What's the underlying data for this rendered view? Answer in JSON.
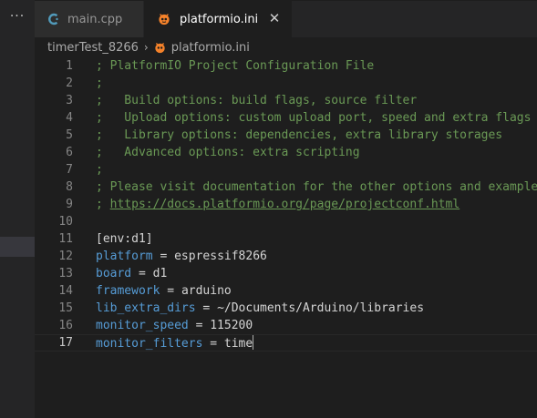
{
  "sidebar": {
    "more_label": "···"
  },
  "tabs": [
    {
      "label": "main.cpp",
      "icon": "cpp-icon",
      "active": false
    },
    {
      "label": "platformio.ini",
      "icon": "platformio-icon",
      "active": true,
      "close": "✕"
    }
  ],
  "breadcrumb": {
    "folder": "timerTest_8266",
    "separator": "›",
    "file": "platformio.ini"
  },
  "editor": {
    "current_line": 17,
    "lines": [
      {
        "n": "1",
        "text": "; PlatformIO Project Configuration File"
      },
      {
        "n": "2",
        "text": ";"
      },
      {
        "n": "3",
        "text": ";   Build options: build flags, source filter"
      },
      {
        "n": "4",
        "text": ";   Upload options: custom upload port, speed and extra flags"
      },
      {
        "n": "5",
        "text": ";   Library options: dependencies, extra library storages"
      },
      {
        "n": "6",
        "text": ";   Advanced options: extra scripting"
      },
      {
        "n": "7",
        "text": ";"
      },
      {
        "n": "8",
        "text": "; Please visit documentation for the other options and examples"
      },
      {
        "n": "9",
        "text_prefix": "; ",
        "link": "https://docs.platformio.org/page/projectconf.html"
      },
      {
        "n": "10",
        "text": ""
      },
      {
        "n": "11",
        "text": "[env:d1]"
      },
      {
        "n": "12",
        "key": "platform",
        "value": "espressif8266"
      },
      {
        "n": "13",
        "key": "board",
        "value": "d1"
      },
      {
        "n": "14",
        "key": "framework",
        "value": "arduino"
      },
      {
        "n": "15",
        "key": "lib_extra_dirs",
        "value": "~/Documents/Arduino/libraries"
      },
      {
        "n": "16",
        "key": "monitor_speed",
        "value": "115200"
      },
      {
        "n": "17",
        "key": "monitor_filters",
        "value": "time"
      }
    ],
    "assign": " = "
  },
  "colors": {
    "background": "#1e1e1e",
    "comment": "#6a9955",
    "key": "#569cd6",
    "text": "#d4d4d4",
    "line_number": "#858585",
    "platformio_orange": "#f5822a",
    "cpp_blue": "#519aba"
  }
}
